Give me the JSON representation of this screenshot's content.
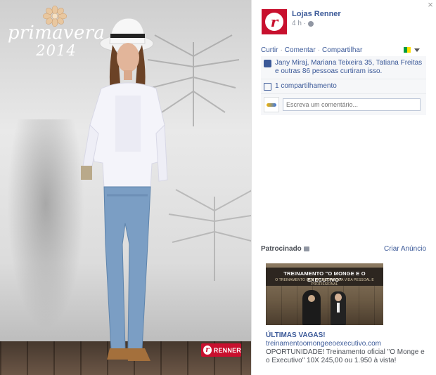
{
  "photo": {
    "campaign_title_line1": "primavera",
    "campaign_title_line2": "2014",
    "brand_badge_text": "RENNER",
    "brand_badge_letter": "r"
  },
  "post": {
    "page_name": "Lojas Renner",
    "timestamp": "4 h",
    "avatar_letter": "r",
    "close_label": "×",
    "actions": [
      "Curtir",
      "Comentar",
      "Compartilhar"
    ],
    "likes_text": "Jany Miraj, Mariana Teixeira 35, Tatiana Freitas e outras 86 pessoas curtiram isso.",
    "shares_text": "1 compartilhamento",
    "comment_placeholder": "Escreva um comentário..."
  },
  "sponsored": {
    "label": "Patrocinado",
    "create_ad": "Criar Anúncio",
    "ad": {
      "banner_title": "TREINAMENTO \"O MONGE E O EXECUTIVO\"",
      "banner_subtitle": "O TREINAMENTO QUE VAI MUDAR SUA VIDA PESSOAL E PROFISSIONAL",
      "title": "ÚLTIMAS VAGAS!",
      "url": "treinamentoomongeeoexecutivo.com",
      "description": "OPORTUNIDADE! Treinamento oficial \"O Monge e o Executivo\" 10X 245,00 ou 1.950 à vista!"
    }
  },
  "colors": {
    "facebook_blue": "#3b5998",
    "renner_red": "#c8102e"
  }
}
